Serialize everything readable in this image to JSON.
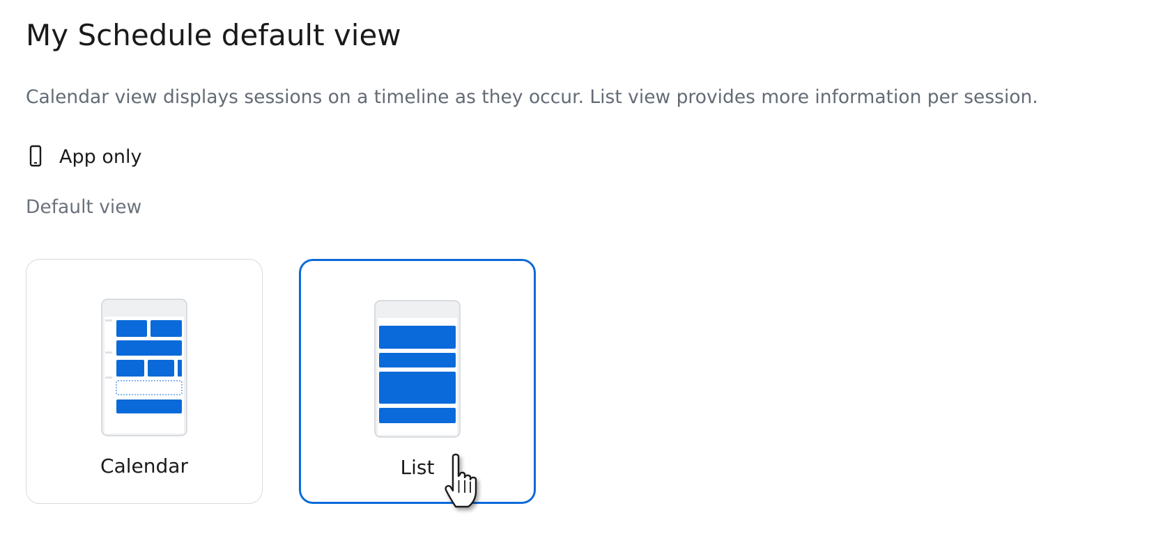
{
  "page": {
    "title": "My Schedule default view",
    "description": "Calendar view displays sessions on a timeline as they occur. List view provides more information per session."
  },
  "platform_note": {
    "icon": "mobile-phone-icon",
    "label": "App only"
  },
  "default_view": {
    "section_label": "Default view",
    "selected": "List",
    "options": [
      {
        "label": "Calendar",
        "icon": "calendar-view-illustration"
      },
      {
        "label": "List",
        "icon": "list-view-illustration"
      }
    ]
  },
  "colors": {
    "accent": "#0b6ad9",
    "card_border": "#d7dadd",
    "muted_text": "#636b75",
    "phone_frame": "#eef0f2"
  }
}
